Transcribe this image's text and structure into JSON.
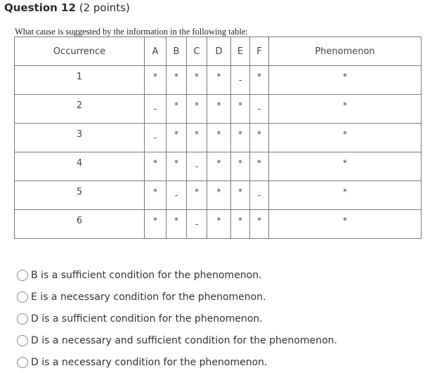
{
  "question": {
    "number_label": "Question 12",
    "points_label": "(2 points)",
    "prompt": "What cause is suggested by the information in the following table:"
  },
  "table": {
    "headers": {
      "occurrence": "Occurrence",
      "factors": [
        "A",
        "B",
        "C",
        "D",
        "E",
        "F"
      ],
      "phenomenon": "Phenomenon"
    },
    "rows": [
      {
        "occurrence": "1",
        "factors": [
          "*",
          "*",
          "*",
          "*",
          "-",
          "*"
        ],
        "phenomenon": "*"
      },
      {
        "occurrence": "2",
        "factors": [
          "-",
          "*",
          "*",
          "*",
          "*",
          "-"
        ],
        "phenomenon": "*"
      },
      {
        "occurrence": "3",
        "factors": [
          "-",
          "*",
          "*",
          "*",
          "*",
          "*"
        ],
        "phenomenon": "*"
      },
      {
        "occurrence": "4",
        "factors": [
          "*",
          "*",
          "-",
          "*",
          "*",
          "*"
        ],
        "phenomenon": "*"
      },
      {
        "occurrence": "5",
        "factors": [
          "*",
          "-",
          "*",
          "*",
          "*",
          "-"
        ],
        "phenomenon": "*"
      },
      {
        "occurrence": "6",
        "factors": [
          "*",
          "*",
          "-",
          "*",
          "*",
          "*"
        ],
        "phenomenon": "*"
      }
    ]
  },
  "options": [
    {
      "label": "B is a sufficient condition for the phenomenon.",
      "selected": false
    },
    {
      "label": "E is a necessary condition for the phenomenon.",
      "selected": false
    },
    {
      "label": "D is a sufficient condition for the phenomenon.",
      "selected": false
    },
    {
      "label": "D is a necessary and sufficient condition for the phenomenon.",
      "selected": false
    },
    {
      "label": "D is a necessary condition for the phenomenon.",
      "selected": false
    }
  ]
}
